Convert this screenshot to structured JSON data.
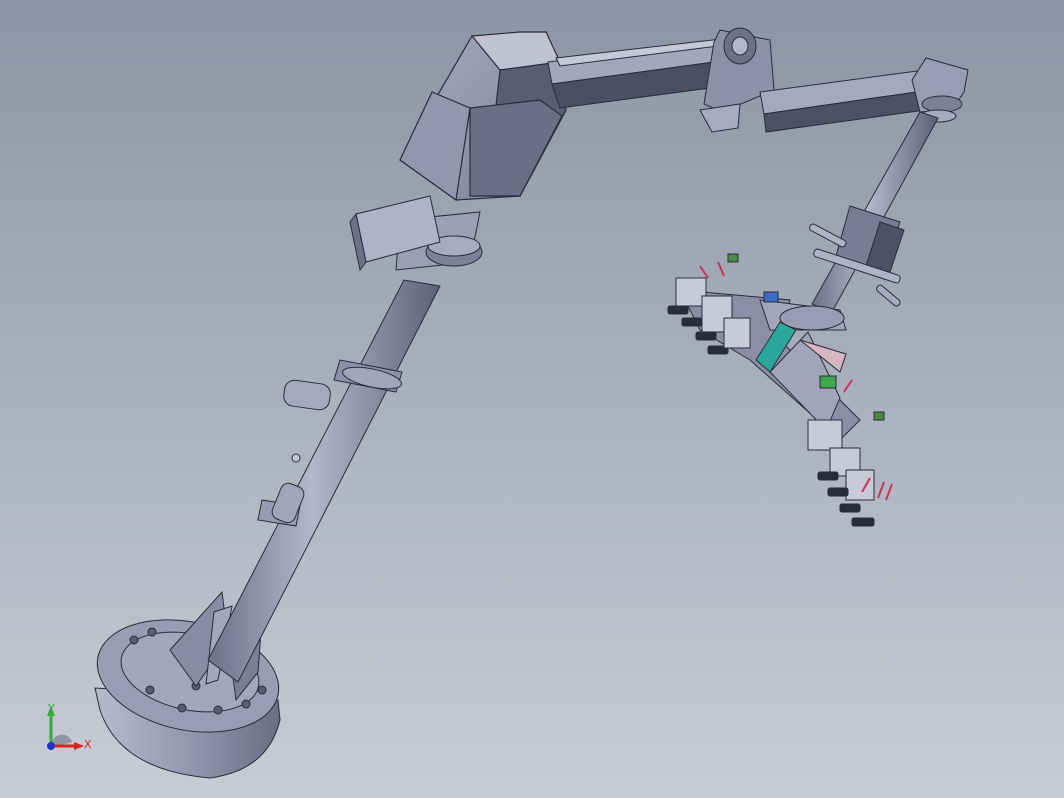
{
  "viewport": {
    "background_top": "#8c95a5",
    "background_bottom": "#c8ccd6"
  },
  "model": {
    "metal_color": "#8e90a8",
    "metal_dark": "#4a4c5e",
    "accent_teal": "#2aa79a",
    "accent_green": "#3fa84a",
    "accent_red": "#c8325a"
  },
  "triad": {
    "x_label": "X",
    "y_label": "Y",
    "x_color": "#d9261c",
    "y_color": "#2fae3a",
    "z_color": "#2233cc"
  }
}
